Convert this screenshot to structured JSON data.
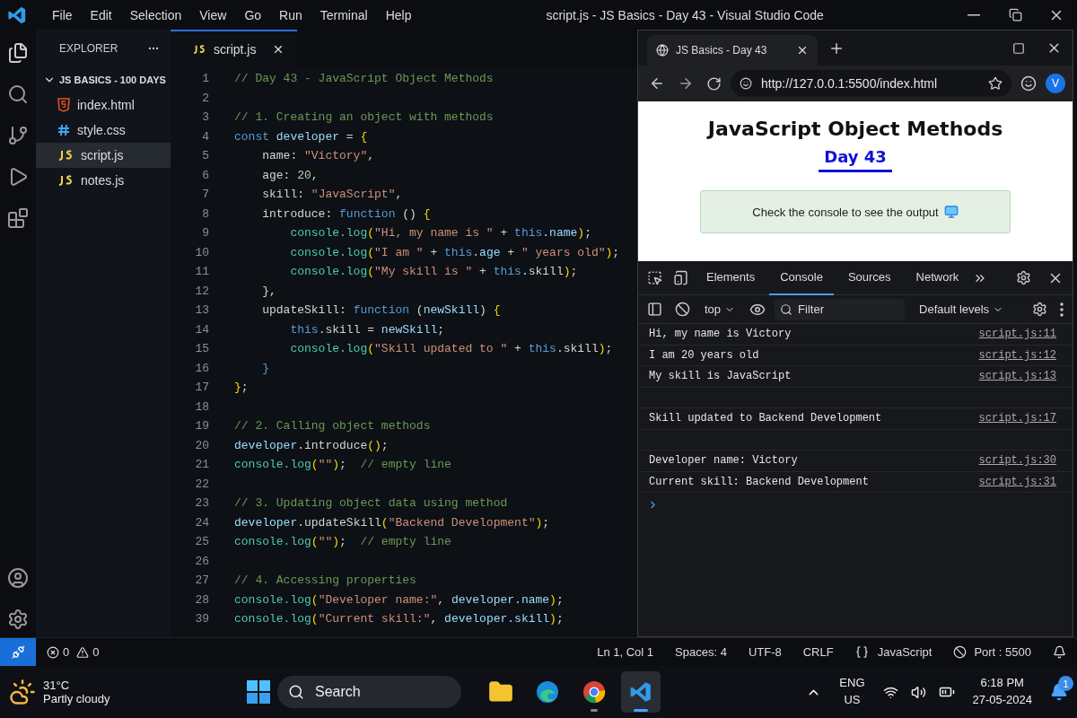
{
  "window": {
    "title": "script.js - JS Basics - Day 43 - Visual Studio Code"
  },
  "menu": [
    "File",
    "Edit",
    "Selection",
    "View",
    "Go",
    "Run",
    "Terminal",
    "Help"
  ],
  "explorer": {
    "title": "EXPLORER",
    "folder": "JS BASICS - 100 DAYS",
    "expanded": true,
    "files": [
      {
        "name": "index.html",
        "kind": "html",
        "selected": false
      },
      {
        "name": "style.css",
        "kind": "css",
        "selected": false
      },
      {
        "name": "script.js",
        "kind": "js",
        "selected": true
      },
      {
        "name": "notes.js",
        "kind": "js",
        "selected": false
      }
    ]
  },
  "editor_tabs": [
    {
      "label": "script.js",
      "kind": "js",
      "selected": true
    }
  ],
  "code": [
    {
      "number": "1",
      "tokens": [
        {
          "t": "// Day 43 - JavaScript Object Methods",
          "kind": "comment"
        }
      ]
    },
    {
      "number": "2"
    },
    {
      "number": "3",
      "tokens": [
        {
          "t": "// 1. Creating an object with methods",
          "kind": "comment"
        }
      ]
    },
    {
      "number": "4",
      "tokens": [
        {
          "t": "const ",
          "kind": "keyword"
        },
        {
          "t": "developer",
          "kind": "ident"
        },
        {
          "t": " = ",
          "kind": "plain"
        },
        {
          "t": "{",
          "kind": "bracket"
        }
      ]
    },
    {
      "number": "5",
      "tokens": [
        {
          "t": "    name: ",
          "kind": "plain"
        },
        {
          "t": "\"Victory\"",
          "kind": "string"
        },
        {
          "t": ",",
          "kind": "plain"
        }
      ]
    },
    {
      "number": "6",
      "tokens": [
        {
          "t": "    age: ",
          "kind": "plain"
        },
        {
          "t": "20",
          "kind": "number"
        },
        {
          "t": ",",
          "kind": "plain"
        }
      ]
    },
    {
      "number": "7",
      "tokens": [
        {
          "t": "    skill: ",
          "kind": "plain"
        },
        {
          "t": "\"JavaScript\"",
          "kind": "string"
        },
        {
          "t": ",",
          "kind": "plain"
        }
      ]
    },
    {
      "number": "8",
      "tokens": [
        {
          "t": "    introduce: ",
          "kind": "plain"
        },
        {
          "t": "function",
          "kind": "keyword"
        },
        {
          "t": " () ",
          "kind": "plain"
        },
        {
          "t": "{",
          "kind": "bracket"
        }
      ]
    },
    {
      "number": "9",
      "tokens": [
        {
          "t": "        console.log",
          "kind": "func"
        },
        {
          "t": "(",
          "kind": "bracket"
        },
        {
          "t": "\"Hi, my name is \"",
          "kind": "string"
        },
        {
          "t": " + ",
          "kind": "plain"
        },
        {
          "t": "this",
          "kind": "keyword"
        },
        {
          "t": ".name",
          "kind": "ident"
        },
        {
          "t": ")",
          "kind": "bracket"
        },
        {
          "t": ";",
          "kind": "plain"
        }
      ]
    },
    {
      "number": "10",
      "tokens": [
        {
          "t": "        console.log",
          "kind": "func"
        },
        {
          "t": "(",
          "kind": "bracket"
        },
        {
          "t": "\"I am \"",
          "kind": "string"
        },
        {
          "t": " + ",
          "kind": "plain"
        },
        {
          "t": "this",
          "kind": "keyword"
        },
        {
          "t": ".age",
          "kind": "ident"
        },
        {
          "t": " + ",
          "kind": "plain"
        },
        {
          "t": "\" years old\"",
          "kind": "string"
        },
        {
          "t": ")",
          "kind": "bracket"
        },
        {
          "t": ";",
          "kind": "plain"
        }
      ]
    },
    {
      "number": "11",
      "tokens": [
        {
          "t": "        console.log",
          "kind": "func"
        },
        {
          "t": "(",
          "kind": "bracket"
        },
        {
          "t": "\"My skill is \"",
          "kind": "string"
        },
        {
          "t": " + ",
          "kind": "plain"
        },
        {
          "t": "this",
          "kind": "keyword"
        },
        {
          "t": ".skill",
          "kind": "plain"
        },
        {
          "t": ")",
          "kind": "bracket"
        },
        {
          "t": ";",
          "kind": "plain"
        }
      ]
    },
    {
      "number": "12",
      "tokens": [
        {
          "t": "    },",
          "kind": "plain"
        }
      ]
    },
    {
      "number": "13",
      "tokens": [
        {
          "t": "    updateSkill: ",
          "kind": "plain"
        },
        {
          "t": "function",
          "kind": "keyword"
        },
        {
          "t": " (",
          "kind": "plain"
        },
        {
          "t": "newSkill",
          "kind": "ident"
        },
        {
          "t": ") ",
          "kind": "plain"
        },
        {
          "t": "{",
          "kind": "bracket"
        }
      ]
    },
    {
      "number": "14",
      "tokens": [
        {
          "t": "        this",
          "kind": "keyword"
        },
        {
          "t": ".skill = ",
          "kind": "plain"
        },
        {
          "t": "newSkill",
          "kind": "ident"
        },
        {
          "t": ";",
          "kind": "plain"
        }
      ]
    },
    {
      "number": "15",
      "tokens": [
        {
          "t": "        console.log",
          "kind": "func"
        },
        {
          "t": "(",
          "kind": "bracket"
        },
        {
          "t": "\"Skill updated to \"",
          "kind": "string"
        },
        {
          "t": " + ",
          "kind": "plain"
        },
        {
          "t": "this",
          "kind": "keyword"
        },
        {
          "t": ".skill",
          "kind": "plain"
        },
        {
          "t": ")",
          "kind": "bracket"
        },
        {
          "t": ";",
          "kind": "plain"
        }
      ]
    },
    {
      "number": "16",
      "tokens": [
        {
          "t": "    }",
          "kind": "keyword"
        }
      ]
    },
    {
      "number": "17",
      "tokens": [
        {
          "t": "}",
          "kind": "bracket"
        },
        {
          "t": ";",
          "kind": "plain"
        }
      ]
    },
    {
      "number": "18"
    },
    {
      "number": "19",
      "tokens": [
        {
          "t": "// 2. Calling object methods",
          "kind": "comment"
        }
      ]
    },
    {
      "number": "20",
      "tokens": [
        {
          "t": "developer",
          "kind": "ident"
        },
        {
          "t": ".introduce",
          "kind": "plain"
        },
        {
          "t": "()",
          "kind": "bracket"
        },
        {
          "t": ";",
          "kind": "plain"
        }
      ]
    },
    {
      "number": "21",
      "tokens": [
        {
          "t": "console.log",
          "kind": "func"
        },
        {
          "t": "(",
          "kind": "bracket"
        },
        {
          "t": "\"\"",
          "kind": "string"
        },
        {
          "t": ")",
          "kind": "bracket"
        },
        {
          "t": ";  ",
          "kind": "plain"
        },
        {
          "t": "// empty line",
          "kind": "comment"
        }
      ]
    },
    {
      "number": "22"
    },
    {
      "number": "23",
      "tokens": [
        {
          "t": "// 3. Updating object data using method",
          "kind": "comment"
        }
      ]
    },
    {
      "number": "24",
      "tokens": [
        {
          "t": "developer",
          "kind": "ident"
        },
        {
          "t": ".updateSkill",
          "kind": "plain"
        },
        {
          "t": "(",
          "kind": "bracket"
        },
        {
          "t": "\"Backend Development\"",
          "kind": "string"
        },
        {
          "t": ")",
          "kind": "bracket"
        },
        {
          "t": ";",
          "kind": "plain"
        }
      ]
    },
    {
      "number": "25",
      "tokens": [
        {
          "t": "console.log",
          "kind": "func"
        },
        {
          "t": "(",
          "kind": "bracket"
        },
        {
          "t": "\"\"",
          "kind": "string"
        },
        {
          "t": ")",
          "kind": "bracket"
        },
        {
          "t": ";  ",
          "kind": "plain"
        },
        {
          "t": "// empty line",
          "kind": "comment"
        }
      ]
    },
    {
      "number": "26"
    },
    {
      "number": "27",
      "tokens": [
        {
          "t": "// 4. Accessing properties",
          "kind": "comment"
        }
      ]
    },
    {
      "number": "28",
      "tokens": [
        {
          "t": "console.log",
          "kind": "func"
        },
        {
          "t": "(",
          "kind": "bracket"
        },
        {
          "t": "\"Developer name:\"",
          "kind": "string"
        },
        {
          "t": ", ",
          "kind": "plain"
        },
        {
          "t": "developer.name",
          "kind": "ident"
        },
        {
          "t": ")",
          "kind": "bracket"
        },
        {
          "t": ";",
          "kind": "plain"
        }
      ]
    },
    {
      "number": "39",
      "tokens": [
        {
          "t": "console.log",
          "kind": "func"
        },
        {
          "t": "(",
          "kind": "bracket"
        },
        {
          "t": "\"Current skill:\"",
          "kind": "string"
        },
        {
          "t": ", ",
          "kind": "plain"
        },
        {
          "t": "developer.skill",
          "kind": "ident"
        },
        {
          "t": ")",
          "kind": "bracket"
        },
        {
          "t": ";",
          "kind": "plain"
        }
      ]
    }
  ],
  "browser": {
    "tab_title": "JS Basics - Day 43",
    "url": "http://127.0.0.1:5500/index.html",
    "profile": "V",
    "page": {
      "heading": "JavaScript Object Methods",
      "subheading": "Day 43",
      "note": "Check the console to see the output"
    },
    "devtools": {
      "tabs": [
        {
          "label": "Elements",
          "selected": false
        },
        {
          "label": "Console",
          "selected": true
        },
        {
          "label": "Sources",
          "selected": false
        },
        {
          "label": "Network",
          "selected": false
        }
      ],
      "context": "top",
      "filter": {
        "placeholder": "Filter"
      },
      "levels": "Default levels",
      "messages": [
        {
          "kind": "log",
          "text": "Hi, my name is Victory",
          "source": "script.js:11"
        },
        {
          "kind": "log",
          "text": "I am 20 years old",
          "source": "script.js:12"
        },
        {
          "kind": "log",
          "text": "My skill is JavaScript",
          "source": "script.js:13"
        },
        {
          "kind": "blank"
        },
        {
          "kind": "log",
          "text": "Skill updated to Backend Development",
          "source": "script.js:17"
        },
        {
          "kind": "blank"
        },
        {
          "kind": "log",
          "text": "Developer name: Victory",
          "source": "script.js:30"
        },
        {
          "kind": "log",
          "text": "Current skill: Backend Development",
          "source": "script.js:31"
        }
      ]
    }
  },
  "status_bar": {
    "errors": "0",
    "warnings": "0",
    "items": [
      "Ln 1, Col 1",
      "Spaces: 4",
      "UTF-8",
      "CRLF"
    ],
    "language": "JavaScript",
    "port": "Port : 5500"
  },
  "taskbar": {
    "temperature": "31°C",
    "weather": "Partly cloudy",
    "search": {
      "placeholder": "Search"
    },
    "apps": [
      {
        "kind": "files",
        "running": false,
        "selected": false
      },
      {
        "kind": "edge",
        "running": false,
        "selected": false
      },
      {
        "kind": "chrome",
        "running": true,
        "selected": false
      },
      {
        "kind": "vscode",
        "running": true,
        "selected": true
      }
    ],
    "language": "ENG",
    "region": "US",
    "time": "6:18 PM",
    "date": "27-05-2024",
    "notifications": "1"
  }
}
